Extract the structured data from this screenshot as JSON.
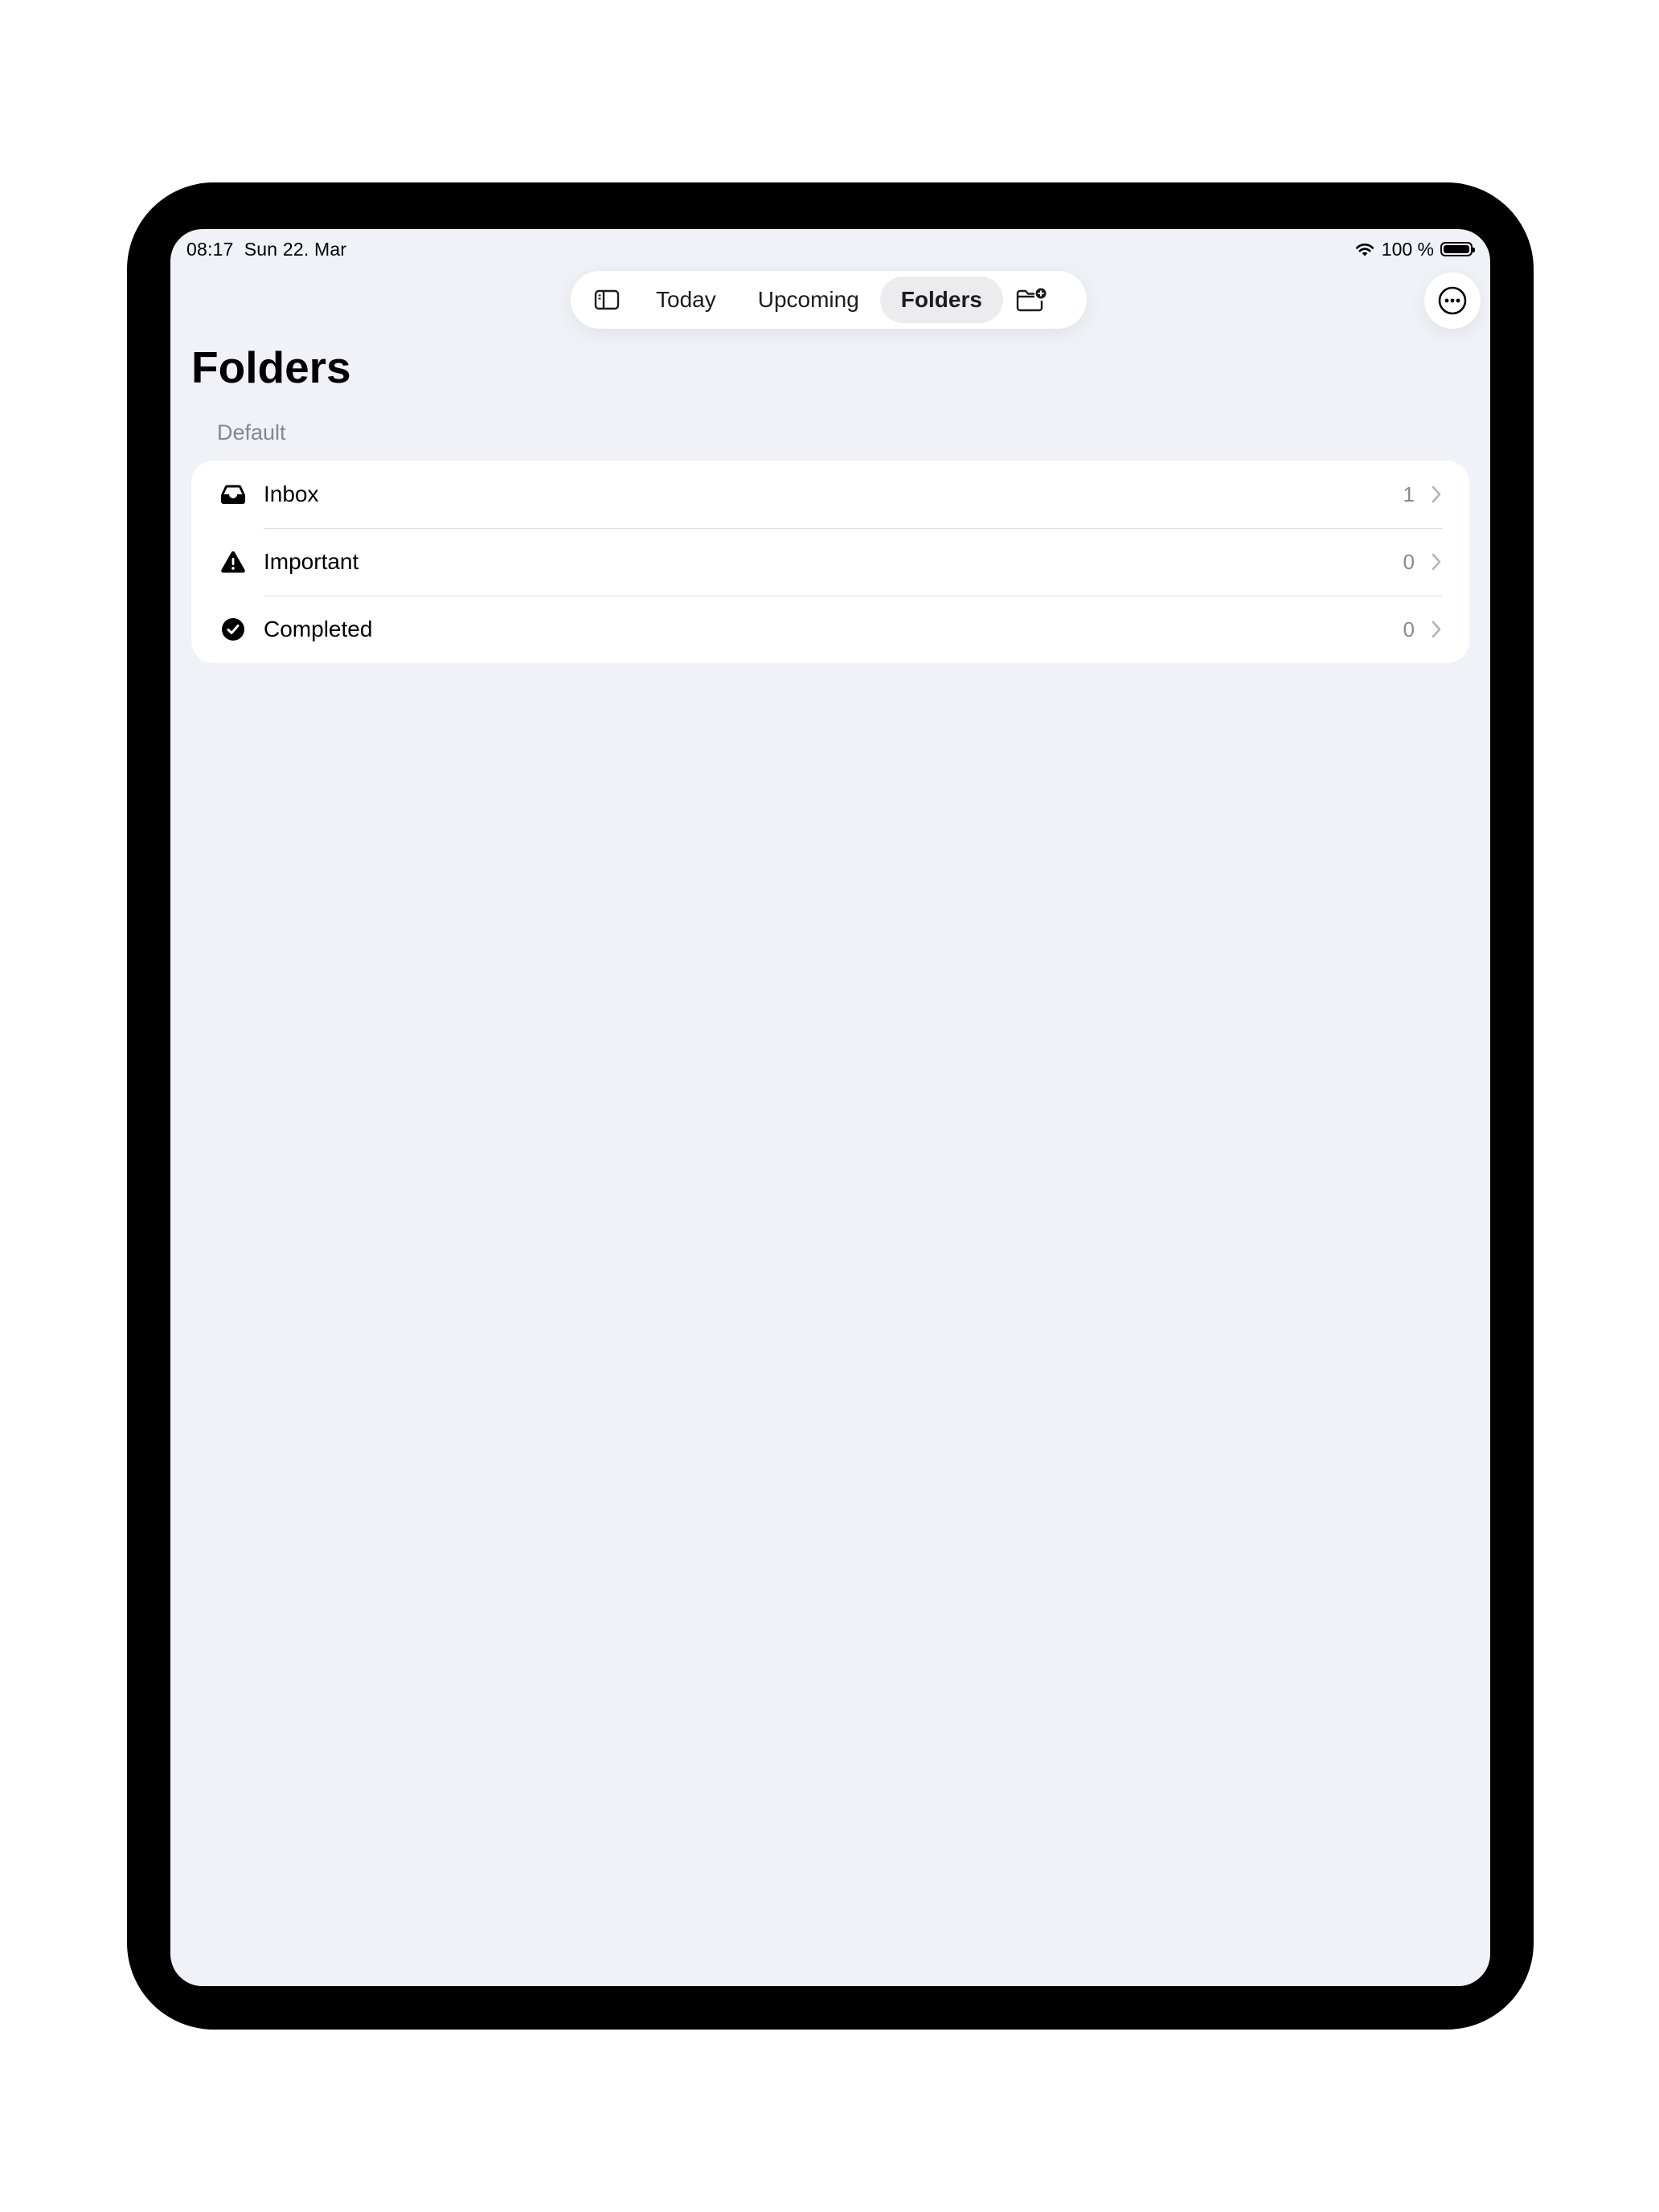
{
  "status_bar": {
    "time": "08:17",
    "date": "Sun 22. Mar",
    "battery_text": "100 %",
    "battery_level": 1.0,
    "icons": [
      "wifi-icon",
      "battery-icon"
    ]
  },
  "toolbar": {
    "sidebar_icon": "sidebar-toggle-icon",
    "tabs": [
      {
        "label": "Today",
        "active": false
      },
      {
        "label": "Upcoming",
        "active": false
      },
      {
        "label": "Folders",
        "active": true
      }
    ],
    "new_folder_icon": "folder-badge-plus-icon"
  },
  "more_icon": "ellipsis-circle-icon",
  "page": {
    "title": "Folders",
    "section": "Default"
  },
  "folders": [
    {
      "label": "Inbox",
      "count": "1",
      "icon": "inbox-tray-icon"
    },
    {
      "label": "Important",
      "count": "0",
      "icon": "warning-triangle-icon"
    },
    {
      "label": "Completed",
      "count": "0",
      "icon": "checkmark-circle-icon"
    }
  ],
  "colors": {
    "background": "#f1f2f8",
    "card": "#ffffff",
    "secondary_text": "#86868b",
    "active_tab": "#ececef"
  }
}
